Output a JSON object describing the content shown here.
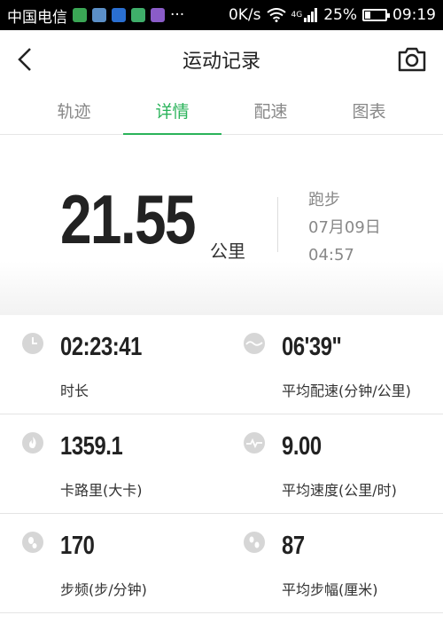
{
  "status_bar": {
    "carrier": "中国电信",
    "overflow": "···",
    "speed": "0K/s",
    "network": "4G",
    "battery": "25%",
    "battery_level": 0.25,
    "time": "09:19"
  },
  "header": {
    "title": "运动记录",
    "back_icon": "chevron-left-icon",
    "camera_icon": "camera-icon"
  },
  "tabs": [
    {
      "label": "轨迹",
      "active": false
    },
    {
      "label": "详情",
      "active": true
    },
    {
      "label": "配速",
      "active": false
    },
    {
      "label": "图表",
      "active": false
    }
  ],
  "summary": {
    "distance": "21.55",
    "unit": "公里",
    "activity": "跑步",
    "date": "07月09日",
    "time": "04:57"
  },
  "stats": [
    {
      "value": "02:23:41",
      "label": "时长",
      "icon": "clock-icon"
    },
    {
      "value": "06'39\"",
      "label": "平均配速(分钟/公里)",
      "icon": "pace-icon"
    },
    {
      "value": "1359.1",
      "label": "卡路里(大卡)",
      "icon": "flame-icon"
    },
    {
      "value": "9.00",
      "label": "平均速度(公里/时)",
      "icon": "speed-icon"
    },
    {
      "value": "170",
      "label": "步频(步/分钟)",
      "icon": "footprint-icon"
    },
    {
      "value": "87",
      "label": "平均步幅(厘米)",
      "icon": "stride-icon"
    }
  ],
  "colors": {
    "accent": "#2ab35a",
    "icon_gray": "#d6d6d6"
  }
}
